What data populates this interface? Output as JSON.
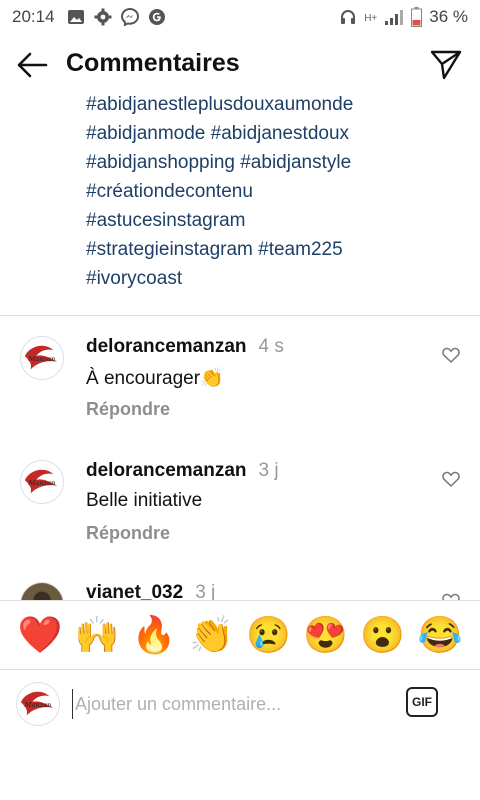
{
  "status_bar": {
    "time": "20:14",
    "network": "H+",
    "battery_percent": "36 %",
    "battery_level": 0.36
  },
  "header": {
    "title": "Commentaires",
    "back_icon": "arrow-left-icon",
    "send_icon": "send-icon"
  },
  "caption": {
    "lines": [
      "#abidjanestleplusdouxaumonde",
      "#abidjanmode #abidjanestdoux",
      "#abidjanshopping #abidjanstyle",
      "#créationdecontenu",
      "#astucesinstagram",
      "#strategieinstagram #team225",
      "#ivorycoast"
    ]
  },
  "comments": [
    {
      "username": "delorancemanzan",
      "time": "4 s",
      "text": "À encourager👏",
      "reply_label": "Répondre"
    },
    {
      "username": "delorancemanzan",
      "time": "3 j",
      "text": "Belle initiative",
      "reply_label": "Répondre"
    },
    {
      "username": "vianet_032",
      "time": "3 j",
      "text": "",
      "reply_label": ""
    }
  ],
  "emoji_bar": [
    "❤️",
    "🙌",
    "🔥",
    "👏",
    "😢",
    "😍",
    "😮",
    "😂"
  ],
  "input": {
    "placeholder": "Ajouter un commentaire...",
    "value": "",
    "gif_label": "GIF"
  },
  "colors": {
    "hashtag": "#1e3f66",
    "muted": "#8e8e8e",
    "divider": "#dedede"
  }
}
